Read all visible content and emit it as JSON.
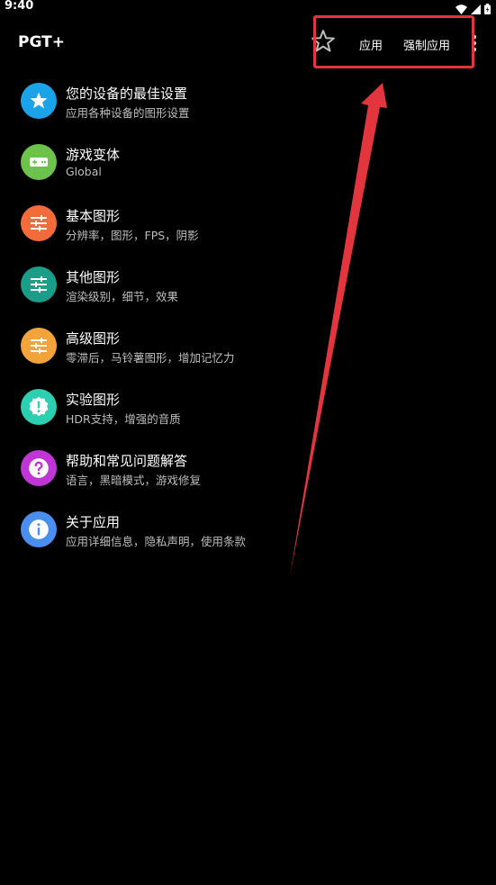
{
  "status_bar": {
    "time": "9:40",
    "icons": [
      "wifi-icon",
      "signal-icon",
      "battery-icon"
    ]
  },
  "app_bar": {
    "title": "PGT+",
    "actions": {
      "favorite_icon": "star-outline-icon",
      "apply_label": "应用",
      "force_apply_label": "强制应用",
      "more_icon": "more-vert-icon"
    }
  },
  "annotation": {
    "color": "#e3353d"
  },
  "menu": {
    "items": [
      {
        "title": "您的设备的最佳设置",
        "subtitle": "应用各种设备的图形设置",
        "icon": "star-icon",
        "color": "#1aa3e8"
      },
      {
        "title": "游戏变体",
        "subtitle": "Global",
        "icon": "gamepad-icon",
        "color": "#6cc24a"
      },
      {
        "title": "基本图形",
        "subtitle": "分辨率，图形，FPS，阴影",
        "icon": "sliders-icon",
        "color": "#f26b3a"
      },
      {
        "title": "其他图形",
        "subtitle": "渲染级别，细节，效果",
        "icon": "sliders-icon",
        "color": "#1a9e8a"
      },
      {
        "title": "高级图形",
        "subtitle": "零滞后，马铃薯图形，增加记忆力",
        "icon": "sliders-icon",
        "color": "#f2a33a"
      },
      {
        "title": "实验图形",
        "subtitle": "HDR支持，增强的音质",
        "icon": "alert-badge-icon",
        "color": "#2ccfb0"
      },
      {
        "title": "帮助和常见问题解答",
        "subtitle": "语言，黑暗模式，游戏修复",
        "icon": "help-icon",
        "color": "#c035d6"
      },
      {
        "title": "关于应用",
        "subtitle": "应用详细信息，隐私声明，使用条款",
        "icon": "info-icon",
        "color": "#4a8ff0"
      }
    ]
  }
}
